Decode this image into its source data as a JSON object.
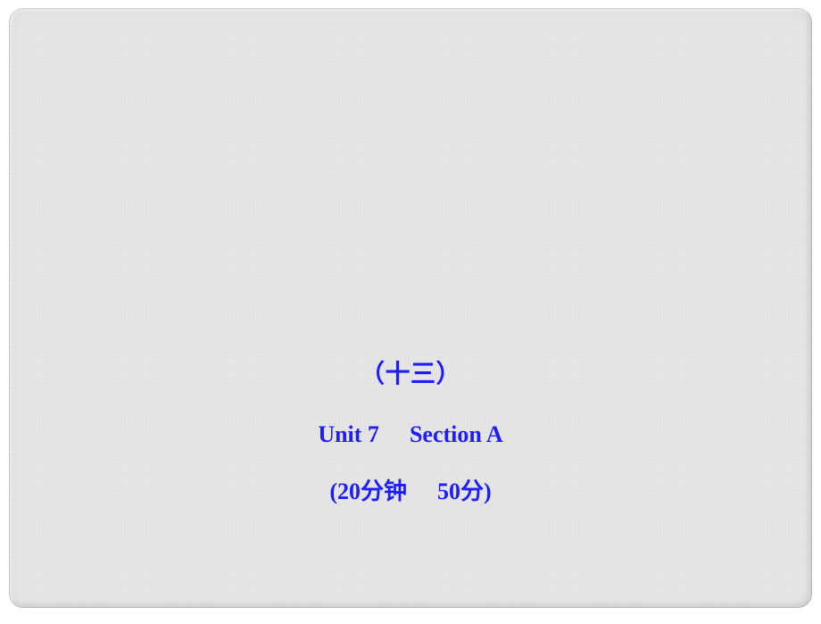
{
  "slide": {
    "line1": "（十三）",
    "line2_unit": "Unit 7",
    "line2_section": "Section A",
    "line3_time": "(20分钟",
    "line3_score": "50分)"
  }
}
